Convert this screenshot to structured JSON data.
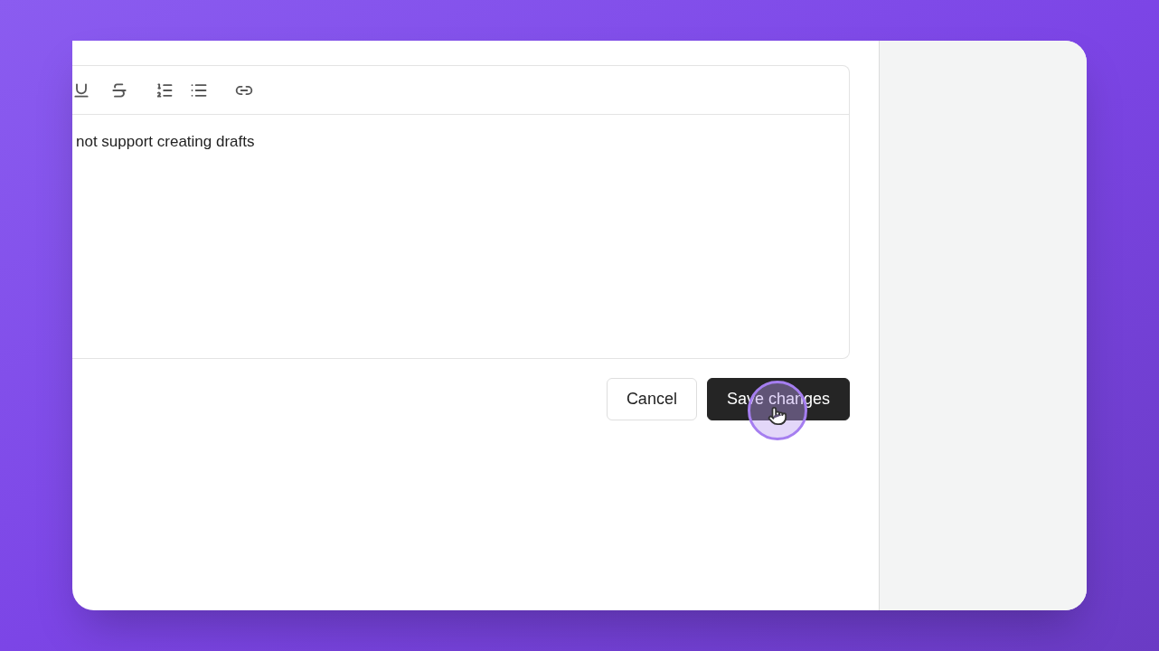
{
  "editor": {
    "toolbar": [
      {
        "kind": "underline"
      },
      {
        "kind": "strikethrough"
      },
      {
        "kind": "ordered-list"
      },
      {
        "kind": "bullet-list"
      },
      {
        "kind": "link"
      }
    ],
    "text": "not support creating drafts"
  },
  "buttons": [
    {
      "label": "Cancel",
      "kind": "secondary"
    },
    {
      "label": "Save changes",
      "kind": "primary",
      "hovered": true
    }
  ]
}
